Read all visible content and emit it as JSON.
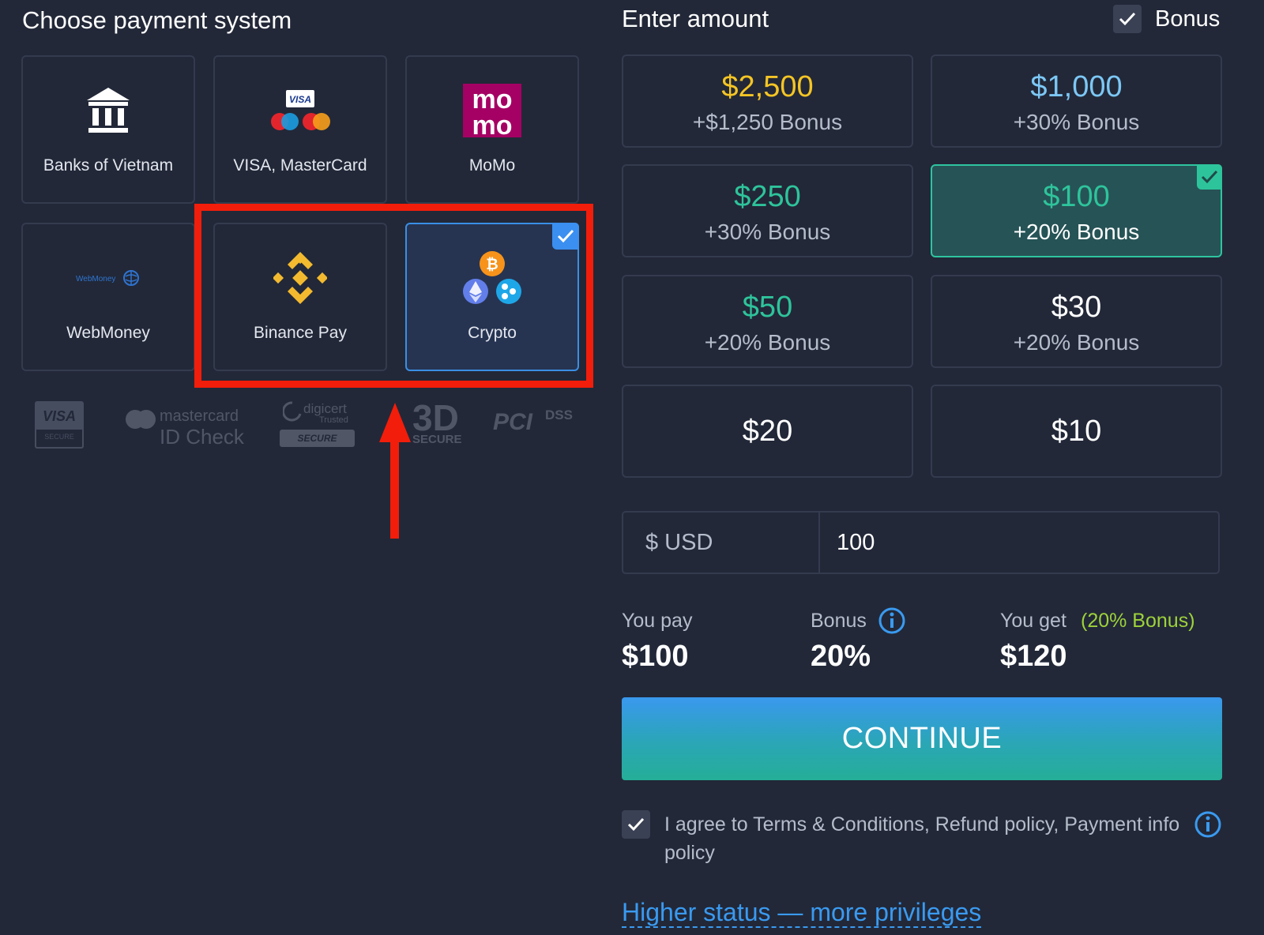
{
  "payment": {
    "title": "Choose payment system",
    "methods": [
      {
        "label": "Banks of Vietnam",
        "icon": "bank-icon",
        "selected": false
      },
      {
        "label": "VISA, MasterCard",
        "icon": "visa-mastercard-icon",
        "selected": false
      },
      {
        "label": "MoMo",
        "icon": "momo-icon",
        "selected": false
      },
      {
        "label": "WebMoney",
        "icon": "webmoney-icon",
        "selected": false
      },
      {
        "label": "Binance Pay",
        "icon": "binance-icon",
        "selected": false
      },
      {
        "label": "Crypto",
        "icon": "crypto-icon",
        "selected": true
      }
    ],
    "security_logos": {
      "visa": "VISA",
      "visa_sub": "SECURE",
      "mastercard": "mastercard",
      "mastercard_sub": "ID Check",
      "digicert": "digicert",
      "digicert_sub": "Trusted",
      "digicert_badge": "SECURE",
      "threed": "3D",
      "threed_sub": "SECURE",
      "pci": "PCI",
      "pci_sub": "DSS"
    }
  },
  "amount": {
    "title": "Enter amount",
    "bonus_toggle_label": "Bonus",
    "bonus_toggle_checked": true,
    "options": [
      {
        "value": "$2,500",
        "bonus": "+$1,250 Bonus",
        "color": "#f5c524",
        "selected": false
      },
      {
        "value": "$1,000",
        "bonus": "+30% Bonus",
        "color": "#7cc7f5",
        "selected": false
      },
      {
        "value": "$250",
        "bonus": "+30% Bonus",
        "color": "#2ec49b",
        "selected": false
      },
      {
        "value": "$100",
        "bonus": "+20% Bonus",
        "color": "#2ec49b",
        "selected": true
      },
      {
        "value": "$50",
        "bonus": "+20% Bonus",
        "color": "#2ec49b",
        "selected": false
      },
      {
        "value": "$30",
        "bonus": "+20% Bonus",
        "color": "#ffffff",
        "selected": false
      },
      {
        "value": "$20",
        "bonus": "",
        "color": "#ffffff",
        "selected": false
      },
      {
        "value": "$10",
        "bonus": "",
        "color": "#ffffff",
        "selected": false
      }
    ],
    "currency_label": "$ USD",
    "input_value": "100"
  },
  "summary": {
    "pay_label": "You pay",
    "pay_value": "$100",
    "bonus_label": "Bonus",
    "bonus_value": "20%",
    "get_label": "You get",
    "get_note": "(20% Bonus)",
    "get_value": "$120"
  },
  "continue_label": "CONTINUE",
  "agree_text": "I agree to Terms & Conditions, Refund policy, Payment info policy",
  "agree_checked": true,
  "status_link": "Higher status — more privileges",
  "colors": {
    "background": "#222838",
    "accent_blue": "#3b8ff0",
    "accent_green": "#2ec49b",
    "highlight_red": "#f21d0a",
    "link_blue": "#3a9af0"
  }
}
